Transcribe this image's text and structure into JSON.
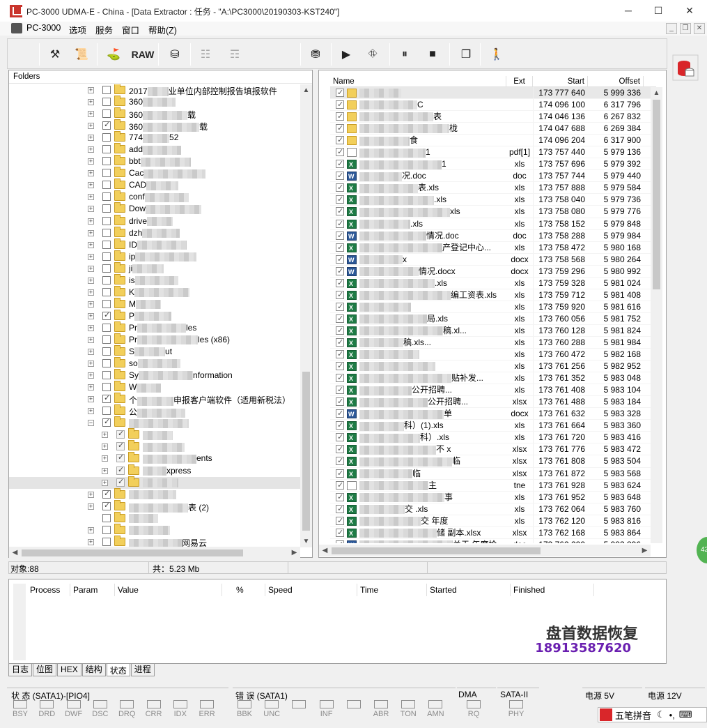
{
  "window": {
    "title": "PC-3000 UDMA-E - China - [Data Extractor : 任务 - \"A:\\PC3000\\20190303-KST240\"]"
  },
  "menu": {
    "items": [
      "PC-3000",
      "选项",
      "服务",
      "窗口",
      "帮助(Z)"
    ]
  },
  "toolbar": {
    "raw_label": "RAW"
  },
  "folders": {
    "header": "Folders",
    "rows": [
      {
        "text": "业单位内部控制报告填报软件",
        "checked": false,
        "prefix": "2017"
      },
      {
        "text": "",
        "checked": false,
        "prefix": "360",
        "suffix": ""
      },
      {
        "text": "载",
        "checked": false,
        "prefix": "360"
      },
      {
        "text": "载",
        "checked": true,
        "prefix": "360"
      },
      {
        "text": "52",
        "checked": false,
        "prefix": "774"
      },
      {
        "text": "",
        "checked": false,
        "prefix": "add"
      },
      {
        "text": "",
        "checked": false,
        "prefix": "bbt"
      },
      {
        "text": "",
        "checked": false,
        "prefix": "Cac"
      },
      {
        "text": "",
        "checked": false,
        "prefix": "CAD"
      },
      {
        "text": "",
        "checked": false,
        "prefix": "conf"
      },
      {
        "text": "",
        "checked": false,
        "prefix": "Dow"
      },
      {
        "text": "",
        "checked": false,
        "prefix": "drive"
      },
      {
        "text": "",
        "checked": false,
        "prefix": "dzh"
      },
      {
        "text": "",
        "checked": false,
        "prefix": "ID"
      },
      {
        "text": "",
        "checked": false,
        "prefix": "ip"
      },
      {
        "text": "",
        "checked": false,
        "prefix": "ji"
      },
      {
        "text": "",
        "checked": false,
        "prefix": "is"
      },
      {
        "text": "",
        "checked": false,
        "prefix": "K"
      },
      {
        "text": "",
        "checked": false,
        "prefix": "M"
      },
      {
        "text": "",
        "checked": true,
        "prefix": "P"
      },
      {
        "text": "les",
        "checked": false,
        "prefix": "Pr"
      },
      {
        "text": "les (x86)",
        "checked": false,
        "prefix": "Pr"
      },
      {
        "text": "ut",
        "checked": false,
        "prefix": "S"
      },
      {
        "text": "",
        "checked": false,
        "prefix": "so"
      },
      {
        "text": "nformation",
        "checked": false,
        "prefix": "Sy"
      },
      {
        "text": "",
        "checked": false,
        "prefix": "W"
      },
      {
        "text": "申报客户端软件（适用新税法）",
        "checked": true,
        "prefix": "个"
      },
      {
        "text": "",
        "checked": false,
        "prefix": "公"
      },
      {
        "text": "",
        "checked": true,
        "prefix": "",
        "expanded": true
      },
      {
        "text": "",
        "checked": true,
        "prefix": "",
        "child": true
      },
      {
        "text": "",
        "checked": true,
        "prefix": "",
        "child": true
      },
      {
        "text": "ents",
        "checked": true,
        "prefix": "",
        "child": true
      },
      {
        "text": "xpress",
        "checked": true,
        "prefix": "",
        "child": true
      },
      {
        "text": "",
        "checked": true,
        "prefix": "",
        "child": true,
        "selected": true
      },
      {
        "text": "",
        "checked": true,
        "prefix": ""
      },
      {
        "text": "表 (2)",
        "checked": true,
        "prefix": ""
      },
      {
        "text": "",
        "checked": false,
        "prefix": "",
        "noexp": true
      },
      {
        "text": "",
        "checked": false,
        "prefix": ""
      },
      {
        "text": "网易云",
        "checked": false,
        "prefix": ""
      }
    ]
  },
  "files": {
    "columns": {
      "name": "Name",
      "ext": "Ext",
      "start": "Start",
      "offset": "Offset"
    },
    "rows": [
      {
        "icon": "folder",
        "name": "",
        "ext": "",
        "start": "173 777 640",
        "offset": "5 999 336",
        "sel": true
      },
      {
        "icon": "folder",
        "name": "C",
        "ext": "",
        "start": "174 096 100",
        "offset": "6 317 796"
      },
      {
        "icon": "folder",
        "name": "表",
        "ext": "",
        "start": "174 046 136",
        "offset": "6 267 832"
      },
      {
        "icon": "folder",
        "name": "栊",
        "ext": "",
        "start": "174 047 688",
        "offset": "6 269 384"
      },
      {
        "icon": "folder",
        "name": "食",
        "ext": "",
        "start": "174 096 204",
        "offset": "6 317 900"
      },
      {
        "icon": "pdf",
        "name": "1",
        "ext": "pdf[1]",
        "start": "173 757 440",
        "offset": "5 979 136"
      },
      {
        "icon": "xls",
        "name": "1",
        "ext": "xls",
        "start": "173 757 696",
        "offset": "5 979 392"
      },
      {
        "icon": "doc",
        "name": "况.doc",
        "ext": "doc",
        "start": "173 757 744",
        "offset": "5 979 440"
      },
      {
        "icon": "xls",
        "name": "表.xls",
        "ext": "xls",
        "start": "173 757 888",
        "offset": "5 979 584"
      },
      {
        "icon": "xls",
        "name": ".xls",
        "ext": "xls",
        "start": "173 758 040",
        "offset": "5 979 736"
      },
      {
        "icon": "xls",
        "name": "xls",
        "ext": "xls",
        "start": "173 758 080",
        "offset": "5 979 776"
      },
      {
        "icon": "xls",
        "name": ".xls",
        "ext": "xls",
        "start": "173 758 152",
        "offset": "5 979 848"
      },
      {
        "icon": "doc",
        "name": "情况.doc",
        "ext": "doc",
        "start": "173 758 288",
        "offset": "5 979 984"
      },
      {
        "icon": "xls",
        "name": "产登记中心...",
        "ext": "xls",
        "start": "173 758 472",
        "offset": "5 980 168"
      },
      {
        "icon": "doc",
        "name": "x",
        "ext": "docx",
        "start": "173 758 568",
        "offset": "5 980 264"
      },
      {
        "icon": "doc",
        "name": "情况.docx",
        "ext": "docx",
        "start": "173 759 296",
        "offset": "5 980 992"
      },
      {
        "icon": "xls",
        "name": ".xls",
        "ext": "xls",
        "start": "173 759 328",
        "offset": "5 981 024"
      },
      {
        "icon": "xls",
        "name": "编工资表.xls",
        "ext": "xls",
        "start": "173 759 712",
        "offset": "5 981 408"
      },
      {
        "icon": "xls",
        "name": "",
        "ext": "xls",
        "start": "173 759 920",
        "offset": "5 981 616"
      },
      {
        "icon": "xls",
        "name": "局.xls",
        "ext": "xls",
        "start": "173 760 056",
        "offset": "5 981 752"
      },
      {
        "icon": "xls",
        "name": "稿.xl...",
        "ext": "xls",
        "start": "173 760 128",
        "offset": "5 981 824"
      },
      {
        "icon": "xls",
        "name": "稿.xls...",
        "ext": "xls",
        "start": "173 760 288",
        "offset": "5 981 984"
      },
      {
        "icon": "xls",
        "name": "",
        "ext": "xls",
        "start": "173 760 472",
        "offset": "5 982 168"
      },
      {
        "icon": "xls",
        "name": "",
        "ext": "xls",
        "start": "173 761 256",
        "offset": "5 982 952"
      },
      {
        "icon": "xls",
        "name": "贴补发...",
        "ext": "xls",
        "start": "173 761 352",
        "offset": "5 983 048"
      },
      {
        "icon": "xls",
        "name": "公开招聘...",
        "ext": "xls",
        "start": "173 761 408",
        "offset": "5 983 104"
      },
      {
        "icon": "xls",
        "name": "公开招聘...",
        "ext": "xlsx",
        "start": "173 761 488",
        "offset": "5 983 184"
      },
      {
        "icon": "doc",
        "name": "单",
        "ext": "docx",
        "start": "173 761 632",
        "offset": "5 983 328"
      },
      {
        "icon": "xls",
        "name": "科）(1).xls",
        "ext": "xls",
        "start": "173 761 664",
        "offset": "5 983 360"
      },
      {
        "icon": "xls",
        "name": "科）.xls",
        "ext": "xls",
        "start": "173 761 720",
        "offset": "5 983 416"
      },
      {
        "icon": "xls",
        "name": "不 x",
        "ext": "xlsx",
        "start": "173 761 776",
        "offset": "5 983 472"
      },
      {
        "icon": "xls",
        "name": "临",
        "ext": "xlsx",
        "start": "173 761 808",
        "offset": "5 983 504"
      },
      {
        "icon": "xls",
        "name": "临",
        "ext": "xlsx",
        "start": "173 761 872",
        "offset": "5 983 568"
      },
      {
        "icon": "tne",
        "name": "主",
        "ext": "tne",
        "start": "173 761 928",
        "offset": "5 983 624"
      },
      {
        "icon": "xls",
        "name": "事",
        "ext": "xls",
        "start": "173 761 952",
        "offset": "5 983 648"
      },
      {
        "icon": "xls",
        "name": "交 .xls",
        "ext": "xls",
        "start": "173 762 064",
        "offset": "5 983 760"
      },
      {
        "icon": "xls",
        "name": "交 年度",
        "ext": "xls",
        "start": "173 762 120",
        "offset": "5 983 816"
      },
      {
        "icon": "xls",
        "name": "储 副本.xlsx",
        "ext": "xlsx",
        "start": "173 762 168",
        "offset": "5 983 864"
      },
      {
        "icon": "doc",
        "name": "关于 年度检",
        "ext": "doc",
        "start": "173 762 200",
        "offset": "5 983 896"
      }
    ]
  },
  "status": {
    "count": "对象:88",
    "total": "共：5.23 Mb"
  },
  "process": {
    "columns": [
      "Process",
      "Param",
      "Value",
      "%",
      "Speed",
      "Time",
      "Started",
      "Finished"
    ],
    "watermark_line1": "盘首数据恢复",
    "watermark_line2": "18913587620"
  },
  "tabs": [
    "日志",
    "位图",
    "HEX",
    "结构",
    "状态",
    "进程"
  ],
  "active_tab": "状态",
  "indicators": {
    "status_group": {
      "label": "状 态 (SATA1)-[PIO4]",
      "leds": [
        "BSY",
        "DRD",
        "DWF",
        "DSC",
        "DRQ",
        "CRR",
        "IDX",
        "ERR"
      ]
    },
    "error_group": {
      "label": "错 误 (SATA1)",
      "leds": [
        "BBK",
        "UNC",
        "",
        "INF",
        "",
        "ABR",
        "TON",
        "AMN"
      ]
    },
    "dma_group": {
      "label": "DMA",
      "leds": [
        "RQ"
      ]
    },
    "sata_group": {
      "label": "SATA-II",
      "leds": [
        "PHY"
      ]
    },
    "power5": {
      "label": "电源 5V"
    },
    "power12": {
      "label": "电源 12V"
    }
  },
  "ime": {
    "label": "五笔拼音"
  },
  "side_badge": "42"
}
